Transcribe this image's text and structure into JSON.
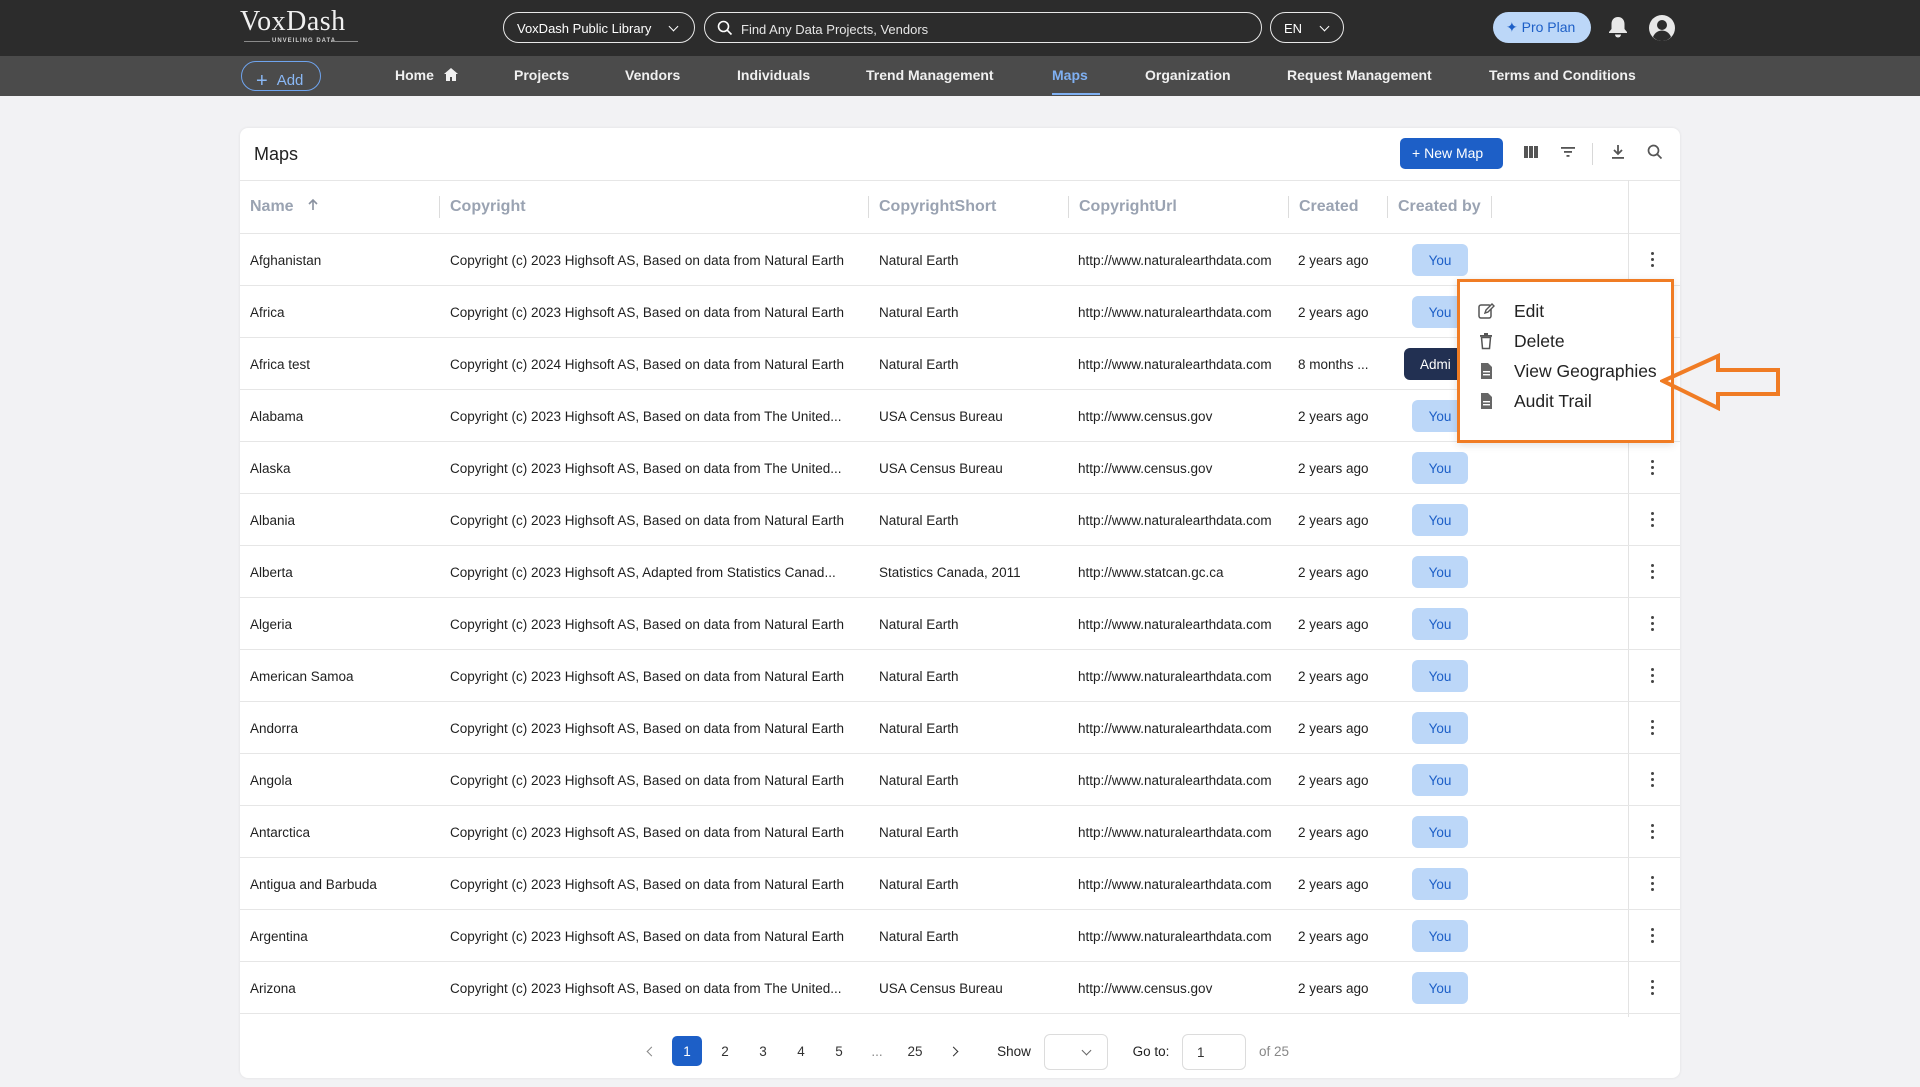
{
  "app": {
    "logo_text": "VoxDash",
    "logo_tagline": "UNVEILING DATA",
    "library_select": "VoxDash Public Library",
    "search_placeholder": "Find Any Data Projects, Vendors",
    "language": "EN",
    "pro_plan": "Pro Plan",
    "brand_color": "#1d5fc7",
    "annotation_color": "#f07c24"
  },
  "nav": {
    "add_label": "Add",
    "items": [
      "Home",
      "Projects",
      "Vendors",
      "Individuals",
      "Trend Management",
      "Maps",
      "Organization",
      "Request Management",
      "Terms and Conditions"
    ],
    "active": "Maps"
  },
  "page": {
    "title": "Maps",
    "new_map_label": "New Map"
  },
  "table": {
    "columns": [
      "Name",
      "Copyright",
      "CopyrightShort",
      "CopyrightUrl",
      "Created",
      "Created by"
    ],
    "sort": {
      "column": "Name",
      "direction": "ascending"
    },
    "rows": [
      {
        "name": "Afghanistan",
        "copyright": "Copyright (c) 2023 Highsoft AS, Based on data from Natural Earth",
        "short": "Natural Earth",
        "url": "http://www.naturalearthdata.com",
        "created": "2 years ago",
        "by": "You"
      },
      {
        "name": "Africa",
        "copyright": "Copyright (c) 2023 Highsoft AS, Based on data from Natural Earth",
        "short": "Natural Earth",
        "url": "http://www.naturalearthdata.com",
        "created": "2 years ago",
        "by": "You"
      },
      {
        "name": "Africa test",
        "copyright": "Copyright (c) 2024 Highsoft AS, Based on data from Natural Earth",
        "short": "Natural Earth",
        "url": "http://www.naturalearthdata.com",
        "created": "8 months ...",
        "by": "Admi"
      },
      {
        "name": "Alabama",
        "copyright": "Copyright (c) 2023 Highsoft AS, Based on data from The United...",
        "short": "USA Census Bureau",
        "url": "http://www.census.gov",
        "created": "2 years ago",
        "by": "You"
      },
      {
        "name": "Alaska",
        "copyright": "Copyright (c) 2023 Highsoft AS, Based on data from The United...",
        "short": "USA Census Bureau",
        "url": "http://www.census.gov",
        "created": "2 years ago",
        "by": "You"
      },
      {
        "name": "Albania",
        "copyright": "Copyright (c) 2023 Highsoft AS, Based on data from Natural Earth",
        "short": "Natural Earth",
        "url": "http://www.naturalearthdata.com",
        "created": "2 years ago",
        "by": "You"
      },
      {
        "name": "Alberta",
        "copyright": "Copyright (c) 2023 Highsoft AS, Adapted from Statistics Canad...",
        "short": "Statistics Canada, 2011",
        "url": "http://www.statcan.gc.ca",
        "created": "2 years ago",
        "by": "You"
      },
      {
        "name": "Algeria",
        "copyright": "Copyright (c) 2023 Highsoft AS, Based on data from Natural Earth",
        "short": "Natural Earth",
        "url": "http://www.naturalearthdata.com",
        "created": "2 years ago",
        "by": "You"
      },
      {
        "name": "American Samoa",
        "copyright": "Copyright (c) 2023 Highsoft AS, Based on data from Natural Earth",
        "short": "Natural Earth",
        "url": "http://www.naturalearthdata.com",
        "created": "2 years ago",
        "by": "You"
      },
      {
        "name": "Andorra",
        "copyright": "Copyright (c) 2023 Highsoft AS, Based on data from Natural Earth",
        "short": "Natural Earth",
        "url": "http://www.naturalearthdata.com",
        "created": "2 years ago",
        "by": "You"
      },
      {
        "name": "Angola",
        "copyright": "Copyright (c) 2023 Highsoft AS, Based on data from Natural Earth",
        "short": "Natural Earth",
        "url": "http://www.naturalearthdata.com",
        "created": "2 years ago",
        "by": "You"
      },
      {
        "name": "Antarctica",
        "copyright": "Copyright (c) 2023 Highsoft AS, Based on data from Natural Earth",
        "short": "Natural Earth",
        "url": "http://www.naturalearthdata.com",
        "created": "2 years ago",
        "by": "You"
      },
      {
        "name": "Antigua and Barbuda",
        "copyright": "Copyright (c) 2023 Highsoft AS, Based on data from Natural Earth",
        "short": "Natural Earth",
        "url": "http://www.naturalearthdata.com",
        "created": "2 years ago",
        "by": "You"
      },
      {
        "name": "Argentina",
        "copyright": "Copyright (c) 2023 Highsoft AS, Based on data from Natural Earth",
        "short": "Natural Earth",
        "url": "http://www.naturalearthdata.com",
        "created": "2 years ago",
        "by": "You"
      },
      {
        "name": "Arizona",
        "copyright": "Copyright (c) 2023 Highsoft AS, Based on data from The United...",
        "short": "USA Census Bureau",
        "url": "http://www.census.gov",
        "created": "2 years ago",
        "by": "You"
      }
    ]
  },
  "context_menu": {
    "items": [
      {
        "label": "Edit",
        "icon": "edit-icon"
      },
      {
        "label": "Delete",
        "icon": "trash-icon"
      },
      {
        "label": "View Geographies",
        "icon": "document-icon"
      },
      {
        "label": "Audit Trail",
        "icon": "document-icon"
      }
    ],
    "highlighted": "View Geographies"
  },
  "pagination": {
    "pages": [
      "1",
      "2",
      "3",
      "4",
      "5",
      "...",
      "25"
    ],
    "current": "1",
    "show_label": "Show",
    "goto_label": "Go to:",
    "goto_value": "1",
    "of_label": "of 25"
  }
}
